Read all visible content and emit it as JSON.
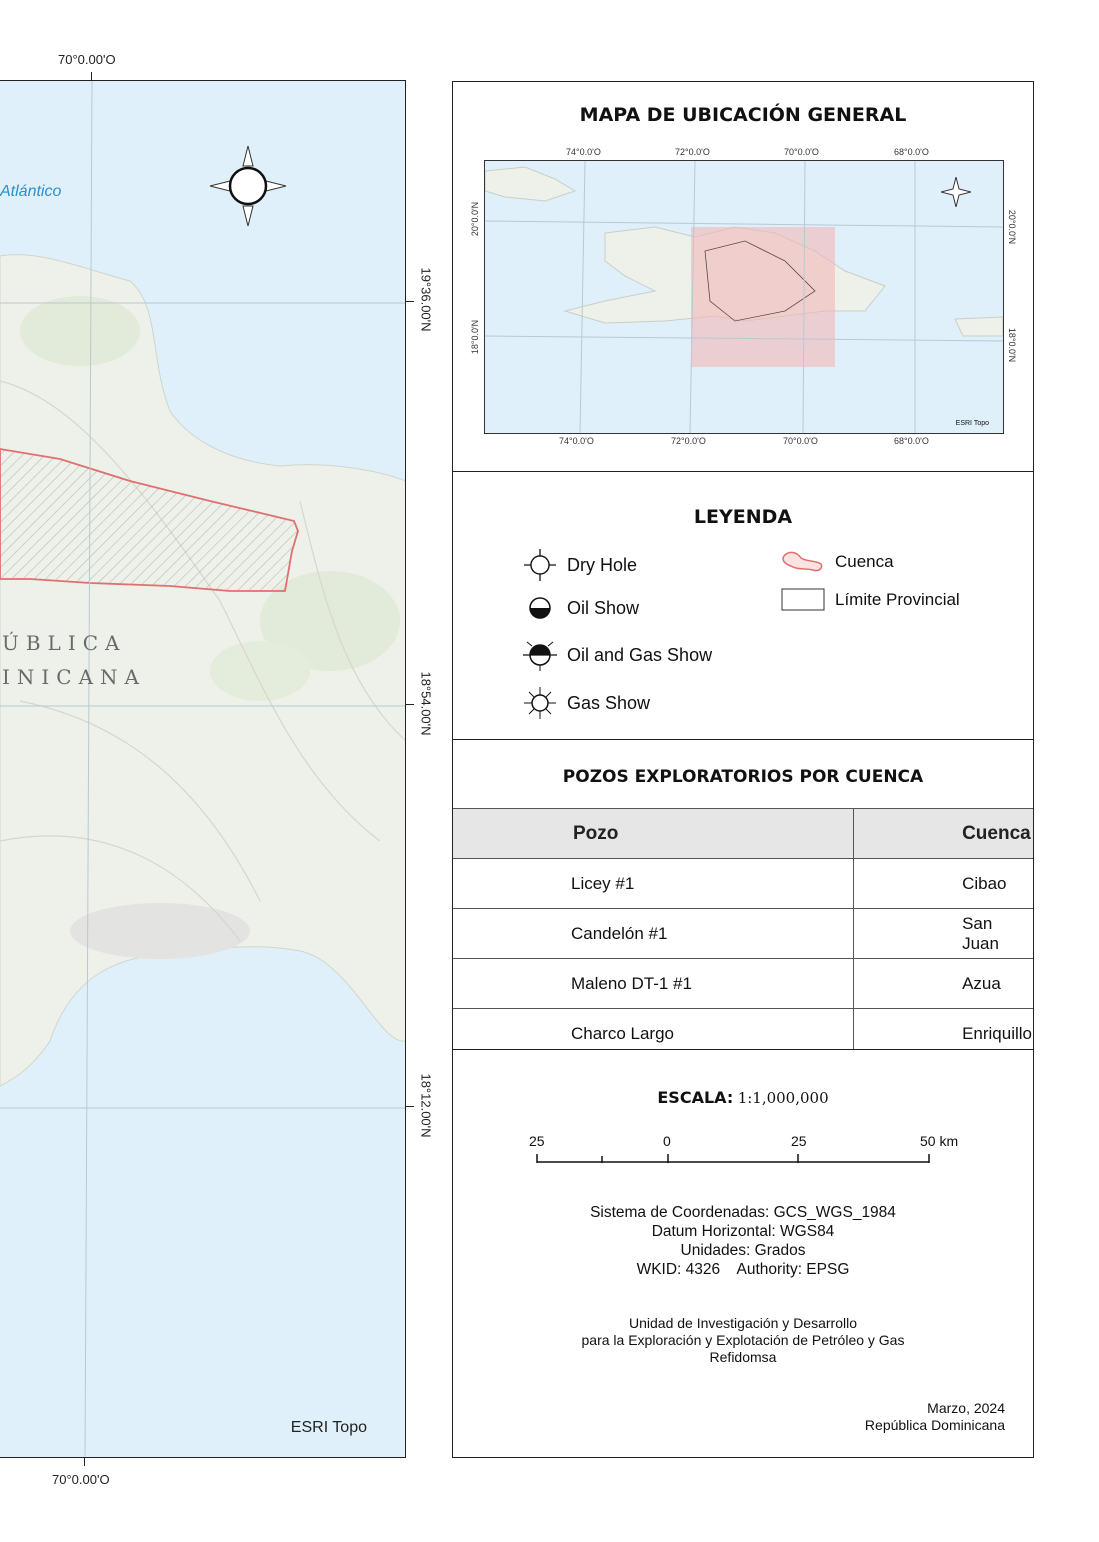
{
  "map": {
    "ocean_label": "Atlántico",
    "country_line1": "ÚBLICA",
    "country_line2": "INICANA",
    "basemap_credit": "ESRI Topo",
    "lon_top": "70°0.00'O",
    "lon_bottom": "70°0.00'O",
    "lat_1": "19°36.00'N",
    "lat_2": "18°54.00'N",
    "lat_3": "18°12.00'N",
    "compass_icon": "compass-rose-icon",
    "colors": {
      "ocean": "#dff0fb",
      "land": "#eef0ea",
      "basin_outline": "#e07070"
    }
  },
  "location_map": {
    "title": "MAPA DE UBICACIÓN GENERAL",
    "top_lon": [
      "74°0.0'O",
      "72°0.0'O",
      "70°0.0'O",
      "68°0.0'O"
    ],
    "bottom_lon": [
      "74°0.0'O",
      "72°0.0'O",
      "70°0.0'O",
      "68°0.0'O"
    ],
    "left_lat": [
      "20°0.0'N",
      "18°0.0'N"
    ],
    "right_lat": [
      "20°0.0'N",
      "18°0.0'N"
    ],
    "credit": "ESRI Topo",
    "highlight_color": "#f2b8b8"
  },
  "legend": {
    "title": "LEYENDA",
    "items": [
      {
        "label": "Dry Hole",
        "icon": "dry-hole-icon"
      },
      {
        "label": "Oil Show",
        "icon": "oil-show-icon"
      },
      {
        "label": "Oil and Gas Show",
        "icon": "oil-gas-show-icon"
      },
      {
        "label": "Gas Show",
        "icon": "gas-show-icon"
      },
      {
        "label": "Cuenca",
        "icon": "basin-icon"
      },
      {
        "label": "Límite Provincial",
        "icon": "province-boundary-icon"
      }
    ]
  },
  "wells": {
    "title": "POZOS EXPLORATORIOS POR CUENCA",
    "headers": [
      "Pozo",
      "Cuenca"
    ],
    "rows": [
      [
        "Licey #1",
        "Cibao"
      ],
      [
        "Candelón #1",
        "San Juan"
      ],
      [
        "Maleno DT-1 #1",
        "Azua"
      ],
      [
        "Charco Largo",
        "Enriquillo"
      ]
    ]
  },
  "scale": {
    "label": "ESCALA:",
    "value": "1:1,000,000",
    "ticks": [
      "25",
      "0",
      "25",
      "50 km"
    ]
  },
  "info": {
    "coord_system": "Sistema de Coordenadas: GCS_WGS_1984",
    "datum": "Datum Horizontal: WGS84",
    "units": "Unidades: Grados",
    "wkid": "WKID: 4326    Authority: EPSG",
    "org1": "Unidad de Investigación y Desarrollo",
    "org2": "para la Exploración y Explotación de Petróleo y Gas",
    "org3": "Refidomsa",
    "date": "Marzo, 2024",
    "country": "República Dominicana"
  }
}
